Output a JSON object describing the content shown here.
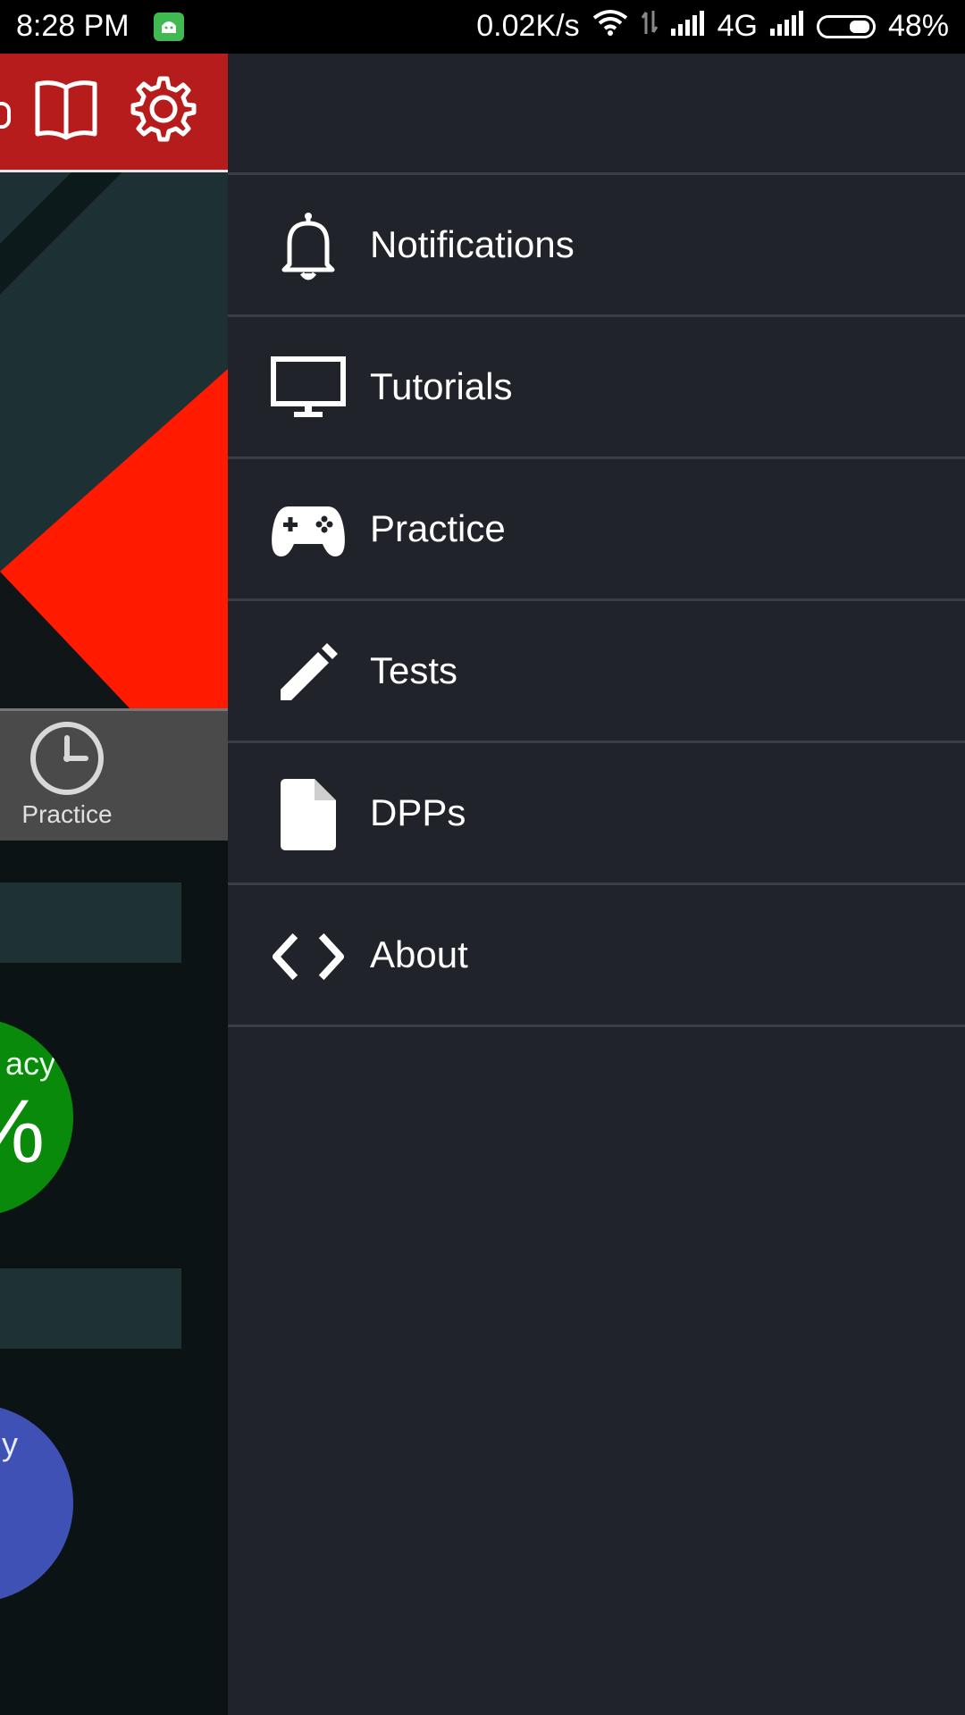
{
  "status_bar": {
    "time": "8:28 PM",
    "net_speed": "0.02K/s",
    "network_type": "4G",
    "battery": "48%"
  },
  "background_app": {
    "tab_label": "Practice",
    "accuracy_label_fragment": "acy",
    "accuracy_value_fragment": "%",
    "second_label_fragment": "y"
  },
  "drawer": {
    "items": [
      {
        "label": "Notifications",
        "icon": "bell-icon"
      },
      {
        "label": "Tutorials",
        "icon": "monitor-icon"
      },
      {
        "label": "Practice",
        "icon": "gamepad-icon"
      },
      {
        "label": "Tests",
        "icon": "pencil-icon"
      },
      {
        "label": "DPPs",
        "icon": "document-icon"
      },
      {
        "label": "About",
        "icon": "code-icon"
      }
    ]
  },
  "colors": {
    "toolbar": "#b71c1c",
    "drawer_bg": "#20232a",
    "accent_red": "#ff1a00",
    "accuracy_green": "#0a8a0a",
    "blue_bubble": "#3f51b5"
  }
}
